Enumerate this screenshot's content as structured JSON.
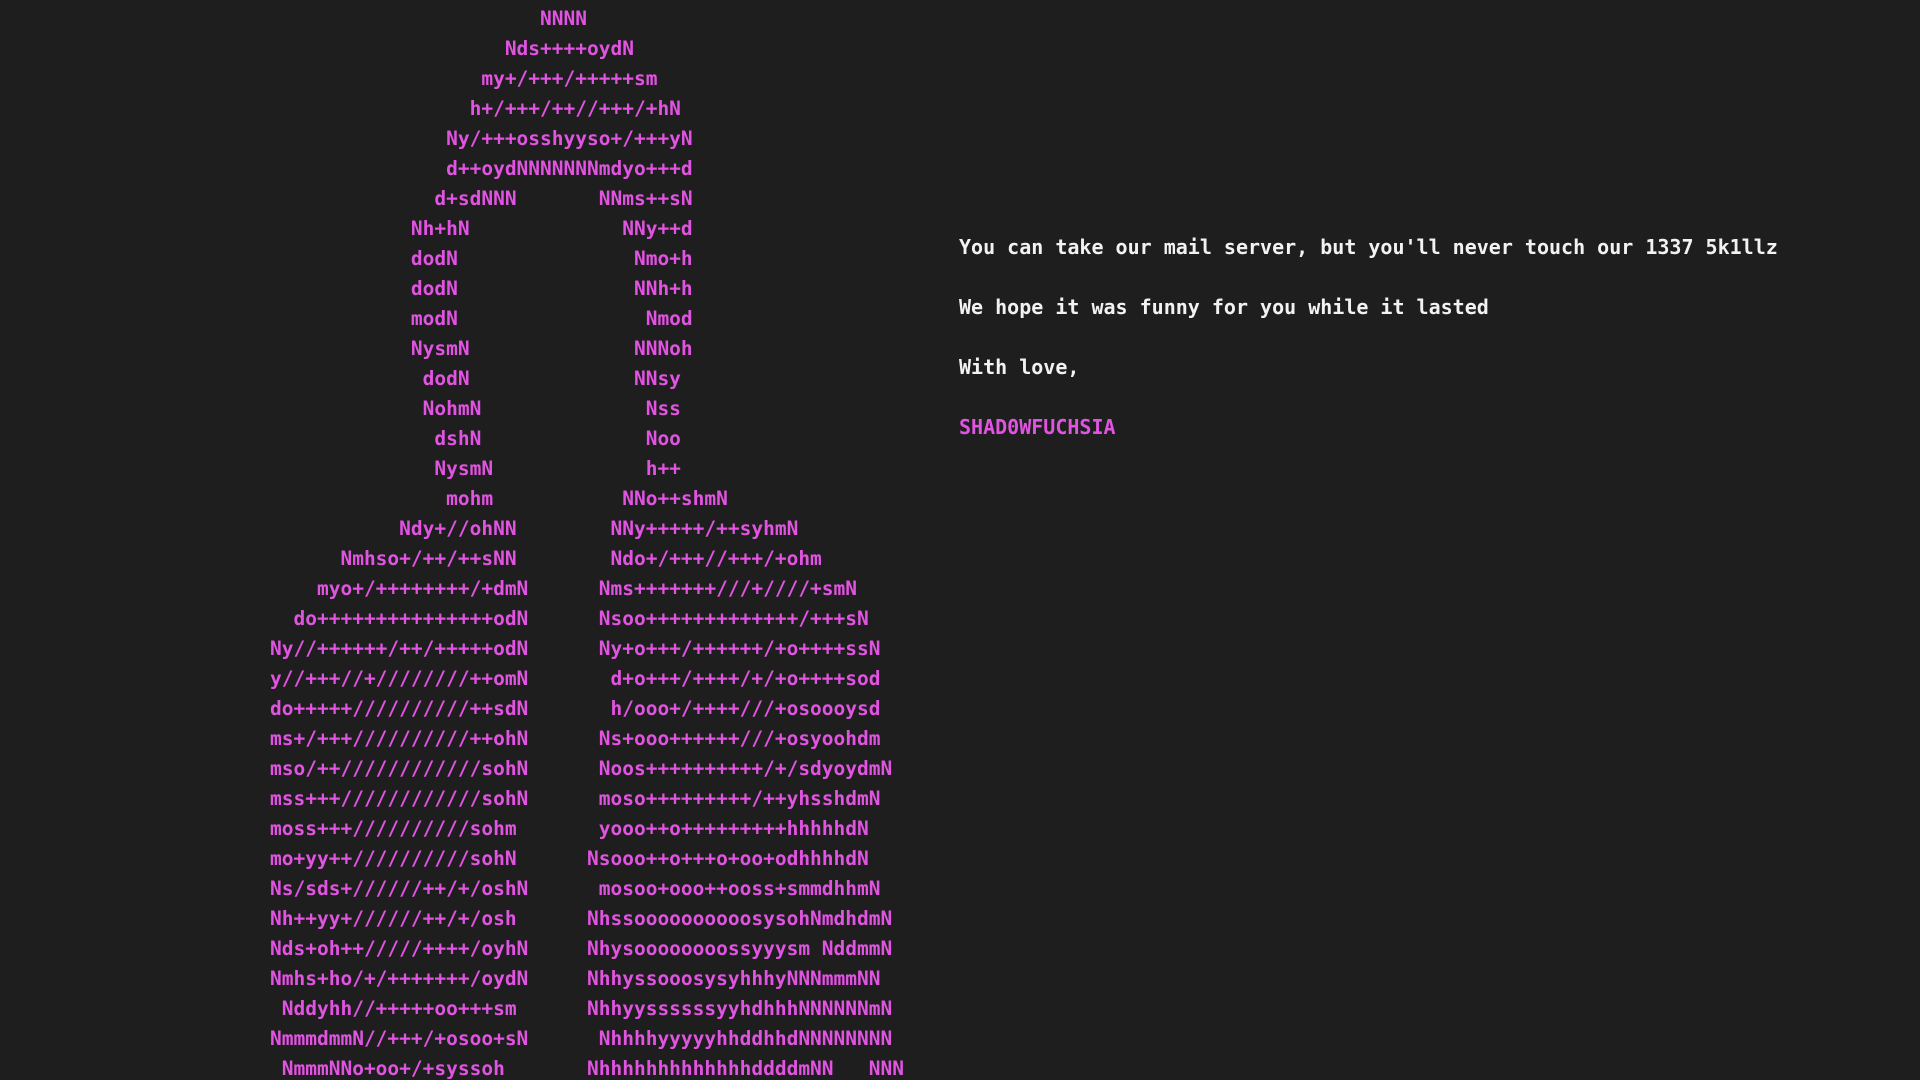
{
  "colors": {
    "background": "#1e1e1e",
    "art": "#e153e1",
    "message": "#f2f2f2",
    "signature": "#e153e1"
  },
  "ascii_art": [
    "                                              NNNN",
    "                                           Nds++++oydN",
    "                                         my+/+++/+++++sm",
    "                                        h+/+++/++//+++/+hN",
    "                                      Ny/+++osshyyso+/+++yN",
    "                                      d++oydNNNNNNNmdyo+++d",
    "                                     d+sdNNN       NNms++sN",
    "                                   Nh+hN             NNy++d",
    "                                   dodN               Nmo+h",
    "                                   dodN               NNh+h",
    "                                   modN                Nmod",
    "                                   NysmN              NNNoh",
    "                                    dodN              NNsy",
    "                                    NohmN              Nss",
    "                                     dshN              Noo",
    "                                     NysmN             h++",
    "                                      mohm           NNo++shmN",
    "                                  Ndy+//ohNN        NNy+++++/++syhmN",
    "                             Nmhso+/++/++sNN        Ndo+/+++//+++/+ohm",
    "                           myo+/++++++++/+dmN      Nms+++++++///+////+smN",
    "                         do+++++++++++++++odN      Nsoo+++++++++++++/+++sN",
    "                       Ny//++++++/++/+++++odN      Ny+o+++/++++++/+o++++ssN",
    "                       y//+++//+////////++omN       d+o+++/++++/+/+o++++sod",
    "                       do+++++//////////++sdN       h/ooo+/++++///+osoooysd",
    "                       ms+/+++//////////++ohN      Ns+ooo++++++///+osyoohdm",
    "                       mso/++////////////sohN      Noos++++++++++/+/sdyoydmN",
    "                       mss+++////////////sohN      moso+++++++++/++yhsshdmN",
    "                       moss+++//////////sohm       yooo++o+++++++++hhhhhdN",
    "                       mo+yy++//////////sohN      Nsooo++o+++o+oo+odhhhhdN",
    "                       Ns/sds+//////++/+/oshN      mosoo+ooo++ooss+smmdhhmN",
    "                       Nh++yy+//////++/+/osh      NhssoooooooooosysohNmdhdmN",
    "                       Nds+oh++/////++++/oyhN     Nhysoooooooossyyysm NddmmN",
    "                       Nmhs+ho/+/+++++++/oydN     NhhyssooosysyhhhyNNNmmmNN",
    "                        Nddyhh//+++++oo+++sm      NhhyyssssssyyhdhhhNNNNNNmN",
    "                       NmmmdmmN//+++/+osoo+sN      NhhhhyyyyyhhddhhdNNNNNNNN",
    "                        NmmmNNo+oo+/+syssoh       NhhhhhhhhhhhhhddddmNN   NNN"
  ],
  "message": {
    "line1": "You can take our mail server, but you'll never touch our 1337 5k1llz",
    "line2": "We hope it was funny for you while it lasted",
    "line3": "With love,",
    "signature": "SHAD0WFUCHSIA"
  }
}
